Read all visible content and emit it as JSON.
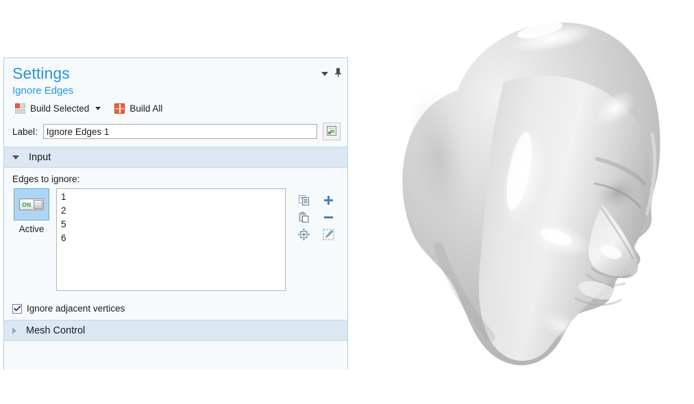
{
  "panel": {
    "title": "Settings",
    "subtitle": "Ignore Edges",
    "collapse_icon": "chevron-down-icon",
    "pin_icon": "pin-icon",
    "toolbar": {
      "build_selected_label": "Build Selected",
      "build_selected_icon": "build-selected-icon",
      "build_selected_caret": "dropdown-caret-icon",
      "build_all_label": "Build All",
      "build_all_icon": "build-all-icon"
    },
    "label_field": {
      "caption": "Label:",
      "value": "Ignore Edges 1",
      "placeholder": "Label",
      "button_icon": "rename-label-icon"
    },
    "sections": [
      {
        "title": "Input",
        "expanded": true,
        "field_caption": "Edges to ignore:",
        "active_toggle": {
          "state_text": "ON",
          "caption": "Active"
        },
        "list_items": [
          "1",
          "2",
          "5",
          "6"
        ],
        "side_buttons": [
          {
            "name": "copy-selection-icon",
            "tooltip": "Copy Selection"
          },
          {
            "name": "add-to-selection-icon",
            "tooltip": "Add to Selection"
          },
          {
            "name": "paste-selection-icon",
            "tooltip": "Paste Selection"
          },
          {
            "name": "remove-from-selection-icon",
            "tooltip": "Remove from Selection"
          },
          {
            "name": "zoom-to-selection-icon",
            "tooltip": "Zoom to Selection"
          },
          {
            "name": "clear-selection-icon",
            "tooltip": "Clear Selection"
          }
        ],
        "checkbox": {
          "label": "Ignore adjacent vertices",
          "checked": true
        }
      },
      {
        "title": "Mesh Control",
        "expanded": false
      }
    ]
  },
  "viewport": {
    "object_name": "head-geometry-render",
    "description": "3D shaded grayscale human head mesh"
  },
  "colors": {
    "accent_blue": "#2196de",
    "section_header_bg": "#dbe7f2",
    "panel_bg": "#f7fafd",
    "panel_border": "#a8d4ef",
    "build_icon_orange": "#e8603c",
    "toggle_on_green": "#1f9d2f",
    "selection_blue": "#aed6f4"
  }
}
